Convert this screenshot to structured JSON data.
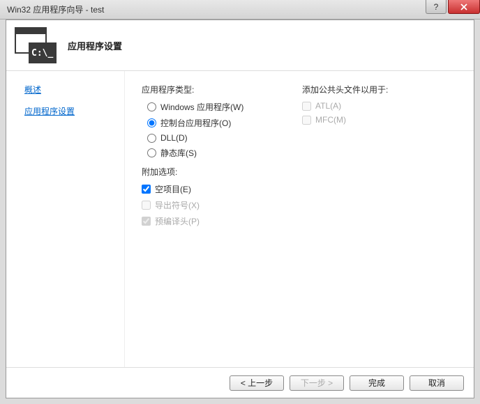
{
  "titlebar": {
    "text": "Win32 应用程序向导 - test",
    "help": "?",
    "close_aria": "Close"
  },
  "header": {
    "title": "应用程序设置",
    "icon_text": "C:\\_"
  },
  "sidebar": {
    "items": [
      {
        "label": "概述"
      },
      {
        "label": "应用程序设置"
      }
    ]
  },
  "main": {
    "app_type": {
      "title": "应用程序类型:",
      "options": [
        {
          "label": "Windows 应用程序(W)",
          "selected": false
        },
        {
          "label": "控制台应用程序(O)",
          "selected": true
        },
        {
          "label": "DLL(D)",
          "selected": false
        },
        {
          "label": "静态库(S)",
          "selected": false
        }
      ]
    },
    "additional": {
      "title": "附加选项:",
      "options": [
        {
          "label": "空项目(E)",
          "checked": true,
          "disabled": false
        },
        {
          "label": "导出符号(X)",
          "checked": false,
          "disabled": true
        },
        {
          "label": "预编译头(P)",
          "checked": true,
          "disabled": true
        }
      ]
    },
    "headers": {
      "title": "添加公共头文件以用于:",
      "options": [
        {
          "label": "ATL(A)",
          "checked": false,
          "disabled": true
        },
        {
          "label": "MFC(M)",
          "checked": false,
          "disabled": true
        }
      ]
    }
  },
  "footer": {
    "prev": "< 上一步",
    "next": "下一步 >",
    "finish": "完成",
    "cancel": "取消"
  }
}
